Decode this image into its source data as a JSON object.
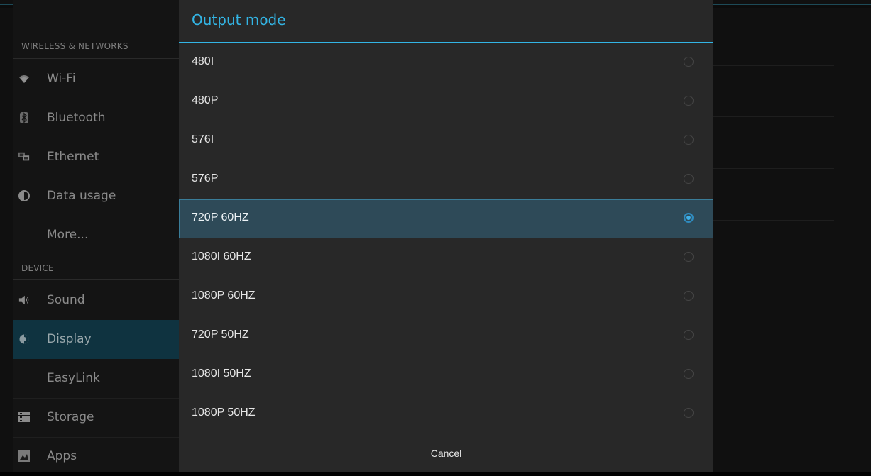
{
  "sidebar": {
    "section_wireless": "WIRELESS & NETWORKS",
    "section_device": "DEVICE",
    "items": [
      {
        "label": "Wi-Fi",
        "icon": "wifi-icon"
      },
      {
        "label": "Bluetooth",
        "icon": "bluetooth-icon"
      },
      {
        "label": "Ethernet",
        "icon": "ethernet-icon"
      },
      {
        "label": "Data usage",
        "icon": "data-usage-icon"
      },
      {
        "label": "More...",
        "icon": ""
      },
      {
        "label": "Sound",
        "icon": "speaker-icon"
      },
      {
        "label": "Display",
        "icon": "brightness-icon"
      },
      {
        "label": "EasyLink",
        "icon": ""
      },
      {
        "label": "Storage",
        "icon": "storage-icon"
      },
      {
        "label": "Apps",
        "icon": "apps-icon"
      }
    ],
    "active_item": "Display"
  },
  "dialog": {
    "title": "Output mode",
    "options": [
      {
        "label": "480I",
        "selected": false
      },
      {
        "label": "480P",
        "selected": false
      },
      {
        "label": "576I",
        "selected": false
      },
      {
        "label": "576P",
        "selected": false
      },
      {
        "label": "720P 60HZ",
        "selected": true
      },
      {
        "label": "1080I 60HZ",
        "selected": false
      },
      {
        "label": "1080P 60HZ",
        "selected": false
      },
      {
        "label": "720P 50HZ",
        "selected": false
      },
      {
        "label": "1080I 50HZ",
        "selected": false
      },
      {
        "label": "1080P 50HZ",
        "selected": false
      }
    ],
    "cancel_label": "Cancel"
  },
  "colors": {
    "accent": "#33b5e5",
    "selected_row": "#2e4a58",
    "dialog_bg": "#282828",
    "sidebar_active": "#0f3340"
  }
}
